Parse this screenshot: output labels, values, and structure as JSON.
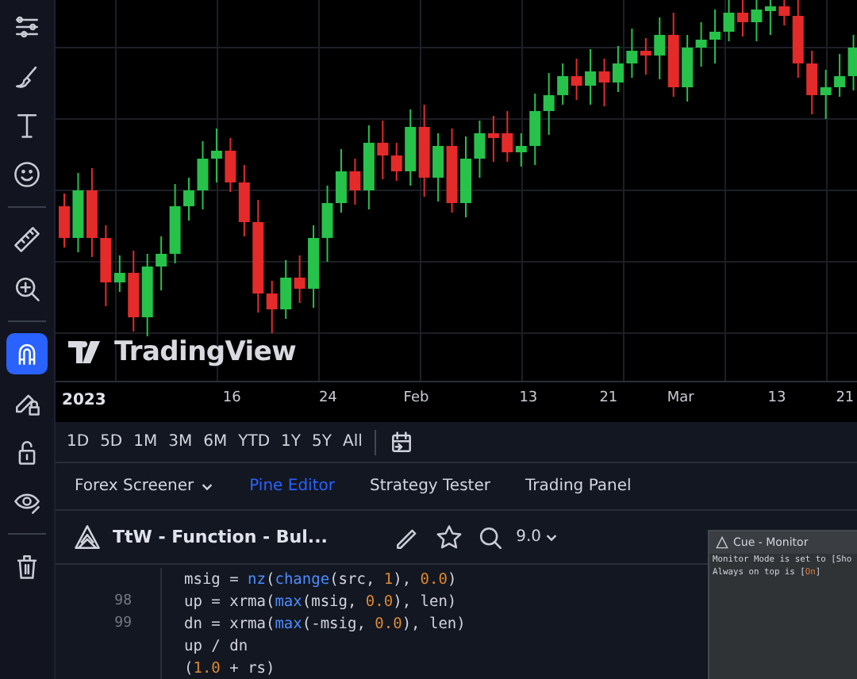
{
  "toolbar": [
    {
      "kind": "lines",
      "selected": false
    },
    {
      "kind": "brush",
      "selected": false
    },
    {
      "kind": "text",
      "selected": false
    },
    {
      "kind": "smiley",
      "selected": false
    },
    {
      "kind": "divider"
    },
    {
      "kind": "ruler",
      "selected": false
    },
    {
      "kind": "zoom",
      "selected": false
    },
    {
      "kind": "divider"
    },
    {
      "kind": "magnet",
      "selected": true
    },
    {
      "kind": "pencil-lock",
      "selected": false
    },
    {
      "kind": "lock",
      "selected": false
    },
    {
      "kind": "eye",
      "selected": false
    },
    {
      "kind": "divider"
    },
    {
      "kind": "trash",
      "selected": false
    }
  ],
  "chart": {
    "logo": "TradingView",
    "year": "2023",
    "dates": [
      {
        "label": "16"
      },
      {
        "label": "24"
      },
      {
        "label": "Feb"
      },
      {
        "label": "13"
      },
      {
        "label": "21"
      },
      {
        "label": "Mar"
      },
      {
        "label": "13"
      },
      {
        "label": "21"
      }
    ]
  },
  "ranges": [
    {
      "label": "1D"
    },
    {
      "label": "5D"
    },
    {
      "label": "1M"
    },
    {
      "label": "3M"
    },
    {
      "label": "6M"
    },
    {
      "label": "YTD"
    },
    {
      "label": "1Y"
    },
    {
      "label": "5Y"
    },
    {
      "label": "All"
    }
  ],
  "tabs": [
    {
      "label": "Forex Screener",
      "selected": false,
      "dropdown": true
    },
    {
      "label": "Pine Editor",
      "selected": true,
      "dropdown": false
    },
    {
      "label": "Strategy Tester",
      "selected": false,
      "dropdown": false
    },
    {
      "label": "Trading Panel",
      "selected": false,
      "dropdown": false
    }
  ],
  "editor": {
    "script_title": "TtW - Function - Bul...",
    "version": "9.0",
    "lines": [
      {
        "segments": [
          {
            "t": "msig = ",
            "kind": "plain"
          },
          {
            "t": "nz",
            "kind": "func"
          },
          {
            "t": "(",
            "kind": "plain"
          },
          {
            "t": "change",
            "kind": "func"
          },
          {
            "t": "(src, ",
            "kind": "plain"
          },
          {
            "t": "1",
            "kind": "num"
          },
          {
            "t": "), ",
            "kind": "plain"
          },
          {
            "t": "0.0",
            "kind": "num"
          },
          {
            "t": ")",
            "kind": "plain"
          }
        ]
      },
      {
        "number": "98",
        "segments": [
          {
            "t": "up = xrma(",
            "kind": "plain"
          },
          {
            "t": "max",
            "kind": "func"
          },
          {
            "t": "(msig, ",
            "kind": "plain"
          },
          {
            "t": "0.0",
            "kind": "num"
          },
          {
            "t": "), len)",
            "kind": "plain"
          }
        ]
      },
      {
        "number": "99",
        "segments": [
          {
            "t": "dn = xrma(",
            "kind": "plain"
          },
          {
            "t": "max",
            "kind": "func"
          },
          {
            "t": "(-msig, ",
            "kind": "plain"
          },
          {
            "t": "0.0",
            "kind": "num"
          },
          {
            "t": "), len)",
            "kind": "plain"
          }
        ]
      },
      {
        "segments": [
          {
            "t": "up / dn",
            "kind": "plain"
          }
        ]
      },
      {
        "segments": [
          {
            "t": "(",
            "kind": "plain"
          },
          {
            "t": "1.0",
            "kind": "num"
          },
          {
            "t": " + rs)",
            "kind": "plain"
          }
        ]
      }
    ]
  },
  "monitor": {
    "title": "Cue - Monitor",
    "lines": [
      [
        {
          "t": "Monitor Mode is set to [Sho",
          "kind": "plain"
        }
      ],
      [
        {
          "t": "Always on top is [",
          "kind": "plain"
        },
        {
          "t": "On",
          "kind": "value"
        },
        {
          "t": "]",
          "kind": "plain"
        }
      ]
    ]
  }
}
